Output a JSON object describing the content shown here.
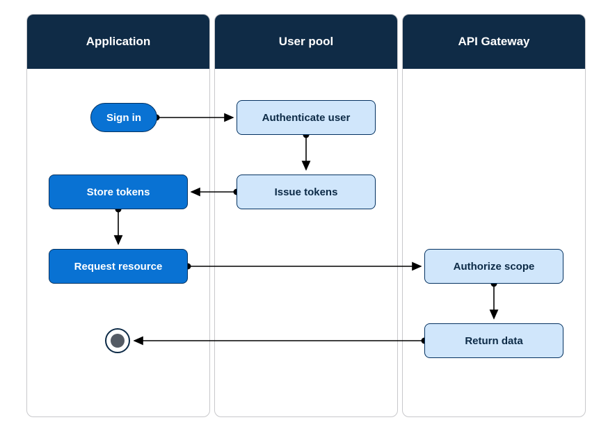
{
  "colors": {
    "header_bg": "#0f2b46",
    "header_text": "#ffffff",
    "primary_fill": "#0972d3",
    "primary_border": "#033160",
    "primary_text": "#ffffff",
    "secondary_fill": "#d0e6fb",
    "secondary_border": "#033160",
    "secondary_text": "#0c2a46",
    "lane_border": "#c8c8cb",
    "connector": "#000000",
    "terminal_fill": "#545b64"
  },
  "lanes": {
    "application": {
      "title": "Application"
    },
    "userpool": {
      "title": "User pool"
    },
    "apigateway": {
      "title": "API Gateway"
    }
  },
  "nodes": {
    "sign_in": {
      "label": "Sign in"
    },
    "authenticate": {
      "label": "Authenticate user"
    },
    "issue_tokens": {
      "label": "Issue tokens"
    },
    "store_tokens": {
      "label": "Store tokens"
    },
    "request_resource": {
      "label": "Request resource"
    },
    "authorize_scope": {
      "label": "Authorize scope"
    },
    "return_data": {
      "label": "Return data"
    }
  }
}
